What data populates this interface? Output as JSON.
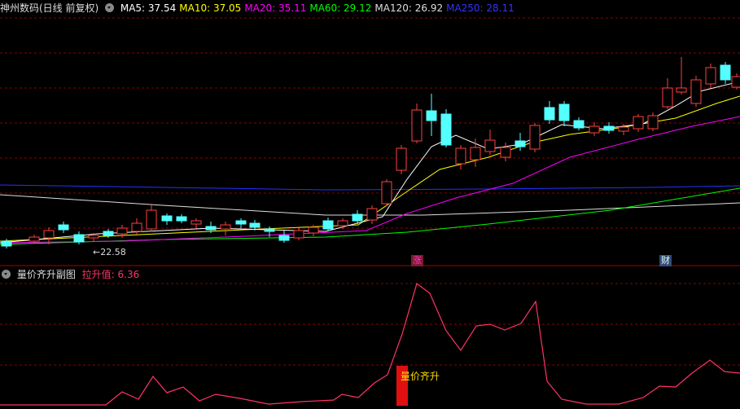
{
  "main_panel": {
    "title": "神州数码(日线 前复权)",
    "ma_legend": [
      {
        "label": "MA5: 37.54",
        "color": "#ffffff"
      },
      {
        "label": "MA10: 37.05",
        "color": "#ffff00"
      },
      {
        "label": "MA20: 35.11",
        "color": "#ff00ff"
      },
      {
        "label": "MA60: 29.12",
        "color": "#00ff00"
      },
      {
        "label": "MA120: 26.92",
        "color": "#dddddd"
      },
      {
        "label": "MA250: 28.11",
        "color": "#3333ff"
      }
    ],
    "low_label": "←22.58",
    "tag_zhang": "涨",
    "tag_cai": "财"
  },
  "sub_panel": {
    "title": "量价齐升副图",
    "value_label": "拉升值: 6.36",
    "value_color": "#ff3366",
    "signal_label": "量价齐升"
  },
  "colors": {
    "up": "#ff4040",
    "down": "#54ffff",
    "grid": "#8b0000",
    "signal_bar": "#e01010"
  }
}
